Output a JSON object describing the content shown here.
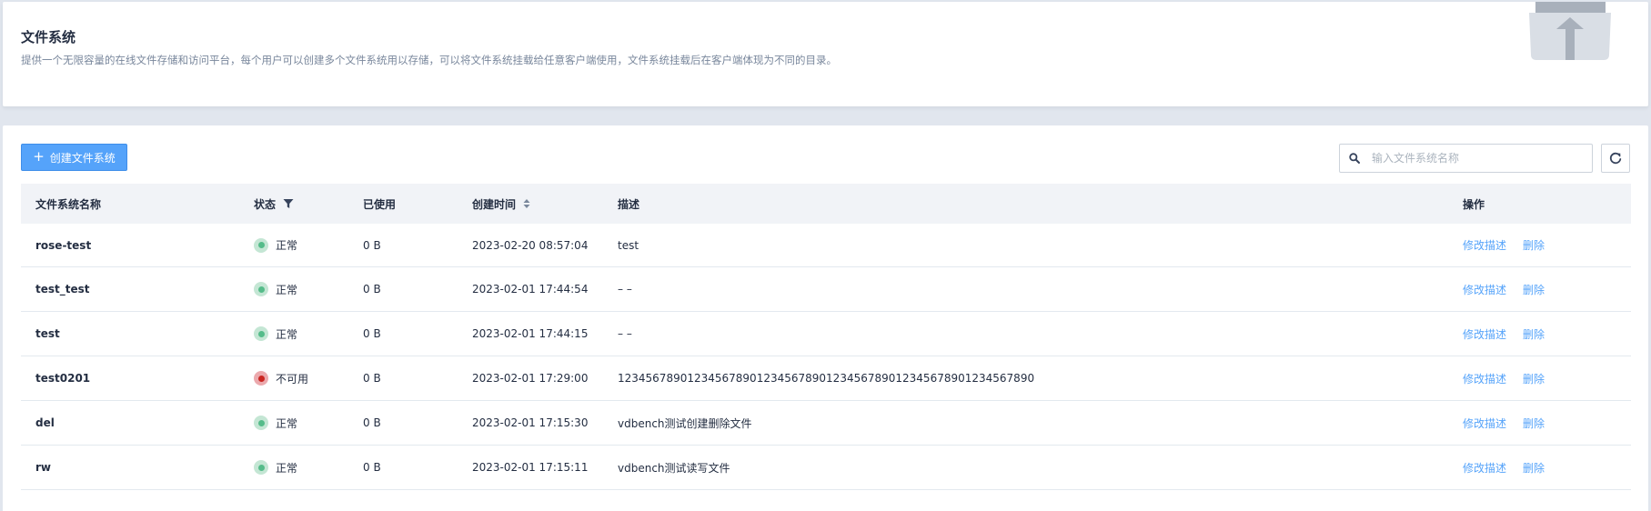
{
  "banner": {
    "title": "文件系统",
    "description": "提供一个无限容量的在线文件存储和访问平台，每个用户可以创建多个文件系统用以存储，可以将文件系统挂载给任意客户端使用，文件系统挂载后在客户端体现为不同的目录。",
    "icon": "folder-upload-icon"
  },
  "toolbar": {
    "create_label": "创建文件系统",
    "search_placeholder": "输入文件系统名称",
    "refresh_icon": "refresh-icon"
  },
  "table": {
    "columns": {
      "name": "文件系统名称",
      "status": "状态",
      "used": "已使用",
      "created": "创建时间",
      "description": "描述",
      "actions": "操作"
    },
    "rows": [
      {
        "name": "rose-test",
        "status": "正常",
        "status_kind": "ok",
        "used": "0 B",
        "created": "2023-02-20 08:57:04",
        "description": "test",
        "edit": "修改描述",
        "delete": "删除"
      },
      {
        "name": "test_test",
        "status": "正常",
        "status_kind": "ok",
        "used": "0 B",
        "created": "2023-02-01 17:44:54",
        "description": "– –",
        "edit": "修改描述",
        "delete": "删除"
      },
      {
        "name": "test",
        "status": "正常",
        "status_kind": "ok",
        "used": "0 B",
        "created": "2023-02-01 17:44:15",
        "description": "– –",
        "edit": "修改描述",
        "delete": "删除"
      },
      {
        "name": "test0201",
        "status": "不可用",
        "status_kind": "bad",
        "used": "0 B",
        "created": "2023-02-01 17:29:00",
        "description": "123456789012345678901234567890123456789012345678901234567890",
        "edit": "修改描述",
        "delete": "删除"
      },
      {
        "name": "del",
        "status": "正常",
        "status_kind": "ok",
        "used": "0 B",
        "created": "2023-02-01 17:15:30",
        "description": "vdbench测试创建删除文件",
        "edit": "修改描述",
        "delete": "删除"
      },
      {
        "name": "rw",
        "status": "正常",
        "status_kind": "ok",
        "used": "0 B",
        "created": "2023-02-01 17:15:11",
        "description": "vdbench测试读写文件",
        "edit": "修改描述",
        "delete": "删除"
      }
    ]
  },
  "colors": {
    "accent": "#55a3fa",
    "status_ok": "#55bc8a",
    "status_bad": "#ca2621",
    "header_bg": "#f1f3f7"
  }
}
